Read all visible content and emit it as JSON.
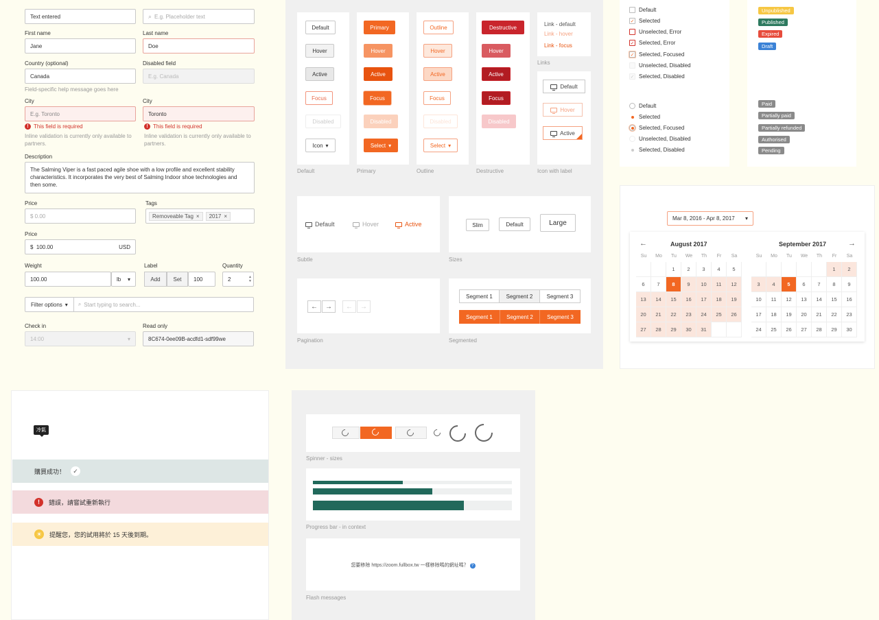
{
  "form": {
    "text_entered": "Text entered",
    "placeholder": "E.g. Placeholder text",
    "first_name_label": "First name",
    "first_name_value": "Jane",
    "last_name_label": "Last name",
    "last_name_value": "Doe",
    "country_label": "Country (optional)",
    "country_value": "Canada",
    "disabled_label": "Disabled field",
    "disabled_placeholder": "E.g. Canada",
    "help_text": "Field-specific help message goes here",
    "city_label": "City",
    "city_placeholder": "E.g. Toronto",
    "city_value": "Toronto",
    "error_required": "This field is required",
    "inline_help": "Inline validation is currently only available to partners.",
    "description_label": "Description",
    "description_value": "The Salming Viper is a fast paced agile shoe with a low profile and excellent stability characteristics. It incorporates the very best of Salming Indoor shoe technologies and then some.",
    "price_label": "Price",
    "price_placeholder": "$  0.00",
    "tags_label": "Tags",
    "tag1": "Removeable Tag",
    "tag2": "2017",
    "price2_label": "Price",
    "price2_prefix": "$",
    "price2_value": "100.00",
    "price2_suffix": "USD",
    "weight_label": "Weight",
    "weight_value": "100.00",
    "weight_unit": "lb",
    "label_label": "Label",
    "label_add": "Add",
    "label_set": "Set",
    "label_value": "100",
    "quantity_label": "Quantity",
    "quantity_value": "2",
    "filter_options": "Filter options",
    "search_placeholder": "Start typing to search...",
    "checkin_label": "Check in",
    "checkin_value": "14:00",
    "readonly_label": "Read only",
    "readonly_value": "8C674-0ee09B-acdfd1-sdf99we"
  },
  "buttons": {
    "default": "Default",
    "hover": "Hover",
    "active": "Active",
    "focus": "Focus",
    "disabled": "Disabled",
    "icon": "Icon",
    "primary": "Primary",
    "select": "Select",
    "outline": "Outline",
    "destructive": "Destructive",
    "link_default": "Link - default",
    "link_hover": "Link - hover",
    "link_focus": "Link - focus",
    "cap_default": "Default",
    "cap_primary": "Primary",
    "cap_outline": "Outline",
    "cap_destructive": "Destructive",
    "cap_links": "Links",
    "cap_icon_label": "Icon with label",
    "subtle_default": "Default",
    "subtle_hover": "Hover",
    "subtle_active": "Active",
    "cap_subtle": "Subtle",
    "size_slim": "Slim",
    "size_default": "Default",
    "size_large": "Large",
    "cap_sizes": "Sizes",
    "cap_pagination": "Pagination",
    "seg1": "Segment 1",
    "seg2": "Segment 2",
    "seg3": "Segment 3",
    "cap_segmented": "Segmented"
  },
  "checkboxes": {
    "default": "Default",
    "selected": "Selected",
    "unsel_error": "Unselected, Error",
    "sel_error": "Selected, Error",
    "sel_focused": "Selected, Focused",
    "unsel_disabled": "Unselected, Disabled",
    "sel_disabled": "Selected, Disabled"
  },
  "radios": {
    "default": "Default",
    "selected": "Selected",
    "sel_focused": "Selected, Focused",
    "unsel_disabled": "Unselected, Disabled",
    "sel_disabled": "Selected, Disabled"
  },
  "badges": {
    "unpublished": "Unpublished",
    "published": "Published",
    "expired": "Expired",
    "draft": "Draft",
    "paid": "Paid",
    "partially_paid": "Partially paid",
    "partially_refunded": "Partially refunded",
    "authorised": "Authorised",
    "pending": "Pending",
    "colors": {
      "unpublished": "#f6c744",
      "published": "#2d7a5f",
      "expired": "#e74c3c",
      "draft": "#3b82d6",
      "gray": "#8a8a8a"
    }
  },
  "calendar": {
    "range": "Mar 8, 2016 - Apr 8, 2017",
    "month1": "August 2017",
    "month2": "September 2017",
    "weekdays": [
      "Su",
      "Mo",
      "Tu",
      "We",
      "Th",
      "Fr",
      "Sa"
    ],
    "prev": "←",
    "next": "→"
  },
  "alerts": {
    "tooltip": "冷氣",
    "success": "購買成功！",
    "error": "錯誤，請嘗試重新執行",
    "warning": "提醒您，您的試用將於 15 天後到期。"
  },
  "spinners": {
    "cap_spinner": "Spinner - sizes",
    "cap_progress": "Progress bar - in context",
    "flash_text": "您要移除 https://zoom.fullbox.tw 一樣移除嗎的網址嗎？",
    "cap_flash": "Flash messages",
    "progress_values": [
      0.45,
      0.6,
      0.76
    ]
  },
  "colors": {
    "accent": "#f26722",
    "destructive": "#c9252c",
    "progress": "#21695b"
  }
}
